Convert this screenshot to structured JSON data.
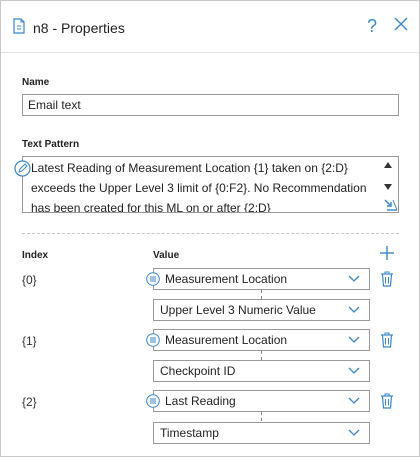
{
  "window": {
    "title": "n8 - Properties",
    "help_label": "?"
  },
  "name": {
    "label": "Name",
    "value": "Email text"
  },
  "text_pattern": {
    "label": "Text Pattern",
    "lines": [
      "Latest Reading of Measurement Location {1} taken on {2:D}",
      "exceeds the Upper Level 3 limit of {0:F2}. No Recommendation",
      "has been created for this ML on or after {2:D}"
    ]
  },
  "table": {
    "index_header": "Index",
    "value_header": "Value",
    "rows": [
      {
        "index": "{0}",
        "primary": "Measurement Location",
        "secondary": "Upper Level 3 Numeric Value"
      },
      {
        "index": "{1}",
        "primary": "Measurement Location",
        "secondary": "Checkpoint ID"
      },
      {
        "index": "{2}",
        "primary": "Last Reading",
        "secondary": "Timestamp"
      }
    ]
  },
  "colors": {
    "accent": "#3a87c8",
    "border": "#999999"
  }
}
